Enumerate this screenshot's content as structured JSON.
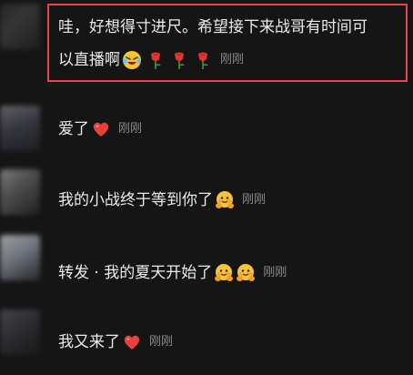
{
  "comments": [
    {
      "text_line1": "哇，好想得寸进尺。希望接下来战哥有时间可",
      "text_line2": "以直播啊",
      "emojis": [
        "laughing-tears-icon",
        "rose-icon",
        "rose-icon",
        "rose-icon"
      ],
      "time": "刚刚"
    },
    {
      "text": "爱了",
      "emojis": [
        "heart-icon"
      ],
      "time": "刚刚"
    },
    {
      "text": "我的小战终于等到你了",
      "emojis": [
        "hug-face-icon"
      ],
      "time": "刚刚"
    },
    {
      "text": "转发 · 我的夏天开始了",
      "emojis": [
        "hug-face-icon",
        "hug-face-icon"
      ],
      "time": "刚刚"
    },
    {
      "text": "我又来了",
      "emojis": [
        "heart-icon"
      ],
      "time": "刚刚"
    }
  ],
  "colors": {
    "background": "#151515",
    "highlight_border": "#e0464b",
    "timestamp": "#8a8a8a",
    "text": "#ebebeb"
  }
}
